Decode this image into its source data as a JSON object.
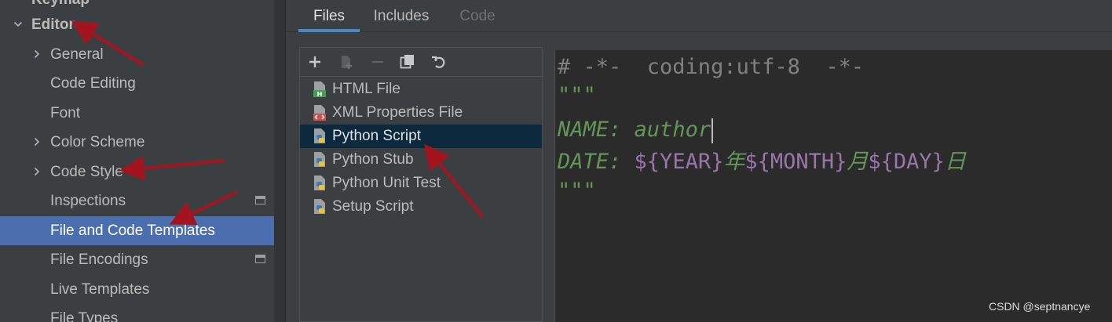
{
  "sidebar": {
    "items": [
      {
        "label": "Keymap",
        "expandable": false,
        "expanded": false,
        "selected": false,
        "bold": true
      },
      {
        "label": "Editor",
        "expandable": true,
        "expanded": true,
        "selected": false,
        "bold": true
      },
      {
        "label": "General",
        "expandable": true,
        "expanded": false,
        "selected": false
      },
      {
        "label": "Code Editing",
        "expandable": false,
        "selected": false
      },
      {
        "label": "Font",
        "expandable": false,
        "selected": false
      },
      {
        "label": "Color Scheme",
        "expandable": true,
        "expanded": false,
        "selected": false
      },
      {
        "label": "Code Style",
        "expandable": true,
        "expanded": false,
        "selected": false
      },
      {
        "label": "Inspections",
        "expandable": false,
        "selected": false,
        "has_badge": true
      },
      {
        "label": "File and Code Templates",
        "expandable": false,
        "selected": true
      },
      {
        "label": "File Encodings",
        "expandable": false,
        "selected": false,
        "has_badge": true
      },
      {
        "label": "Live Templates",
        "expandable": false,
        "selected": false
      },
      {
        "label": "File Types",
        "expandable": false,
        "selected": false
      }
    ]
  },
  "tabs": [
    {
      "label": "Files",
      "active": true,
      "disabled": false
    },
    {
      "label": "Includes",
      "active": false,
      "disabled": false
    },
    {
      "label": "Code",
      "active": false,
      "disabled": true
    }
  ],
  "toolbar": {
    "buttons": [
      {
        "name": "add-icon",
        "enabled": true
      },
      {
        "name": "add-child-icon",
        "enabled": false
      },
      {
        "name": "remove-icon",
        "enabled": false
      },
      {
        "name": "copy-icon",
        "enabled": true
      },
      {
        "name": "reset-icon",
        "enabled": true
      }
    ]
  },
  "templates": {
    "items": [
      {
        "label": "HTML File",
        "icon": "html-file-icon",
        "selected": false
      },
      {
        "label": "XML Properties File",
        "icon": "xml-file-icon",
        "selected": false
      },
      {
        "label": "Python Script",
        "icon": "python-file-icon",
        "selected": true
      },
      {
        "label": "Python Stub",
        "icon": "python-file-icon",
        "selected": false
      },
      {
        "label": "Python Unit Test",
        "icon": "python-file-icon",
        "selected": false
      },
      {
        "label": "Setup Script",
        "icon": "python-file-icon",
        "selected": false
      }
    ]
  },
  "editor": {
    "line1": "# -*-  coding:utf-8  -*-",
    "line2": "\"\"\"",
    "line3_key": "NAME: ",
    "line3_value": "author",
    "line4_key": "DATE: ",
    "line4_var1": "${YEAR}",
    "line4_sep1": "年",
    "line4_var2": "${MONTH}",
    "line4_sep2": "月",
    "line4_var3": "${DAY}",
    "line4_sep3": "日",
    "line5": "\"\"\""
  },
  "watermark": "CSDN @septnancye",
  "colors": {
    "background": "#3c3f41",
    "selection": "#4b6eaf",
    "list_selection": "#0d293e",
    "editor_bg": "#2b2b2b",
    "comment": "#808080",
    "string_green": "#629755",
    "template_var": "#9876aa",
    "annotation_arrow": "#a4141f"
  }
}
